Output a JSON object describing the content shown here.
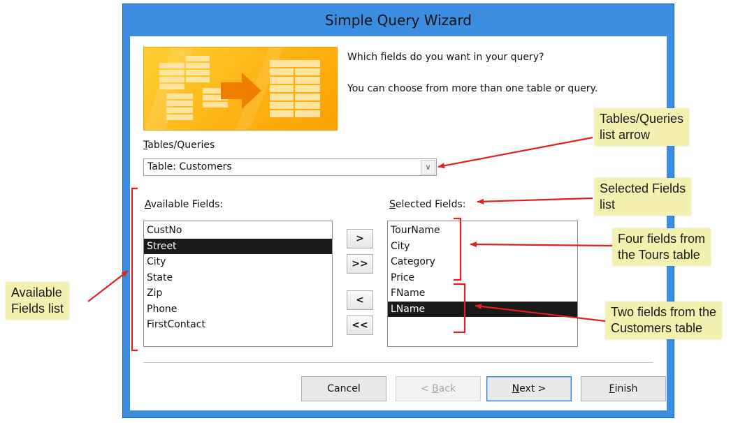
{
  "window": {
    "title": "Simple Query Wizard"
  },
  "prompt": {
    "line1": "Which fields do you want in your query?",
    "line2": "You can choose from more than one table or query."
  },
  "tables_queries": {
    "label": "Tables/Queries",
    "accessKey": "T",
    "value": "Table: Customers"
  },
  "available_fields": {
    "label": "Available Fields:",
    "accessKey": "A",
    "items": [
      "CustNo",
      "Street",
      "City",
      "State",
      "Zip",
      "Phone",
      "FirstContact"
    ],
    "selected": "Street"
  },
  "selected_fields": {
    "label": "Selected Fields:",
    "accessKey": "S",
    "items": [
      "TourName",
      "City",
      "Category",
      "Price",
      "FName",
      "LName"
    ],
    "selected": "LName"
  },
  "move_buttons": {
    "add_one": ">",
    "add_all": ">>",
    "remove_one": "<",
    "remove_all": "<<"
  },
  "buttons": {
    "cancel": "Cancel",
    "back": "< Back",
    "back_key": "B",
    "next": "Next >",
    "next_key": "N",
    "finish": "Finish",
    "finish_key": "F"
  },
  "callouts": {
    "tables_arrow": [
      "Tables/Queries",
      "list arrow"
    ],
    "selected_list": [
      "Selected Fields",
      "list"
    ],
    "four_fields": [
      "Four fields from",
      "the Tours table"
    ],
    "two_fields": [
      "Two fields from the",
      "Customers table"
    ],
    "available_list": [
      "Available",
      "Fields list"
    ]
  },
  "colors": {
    "title_bar": "#3a8de0",
    "callout_bg": "#f3f0b0",
    "annotation_red": "#e02020",
    "selection": "#1a1a1a"
  }
}
